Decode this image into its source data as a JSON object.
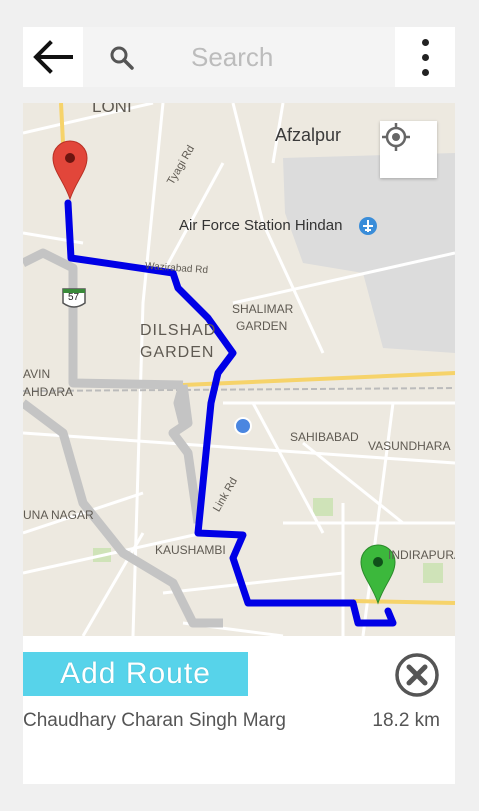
{
  "header": {
    "search_placeholder": "Search"
  },
  "map": {
    "labels": {
      "loni": "LONI",
      "afzalpur": "Afzalpur",
      "tyagi_rd": "Tyagi Rd",
      "airforce": "Air Force Station Hindan",
      "wazirabad": "Wazirabad Rd",
      "nh57": "57",
      "dilshad": "DILSHAD",
      "garden": "GARDEN",
      "shalimar": "SHALIMAR",
      "shalimar_garden": "GARDEN",
      "avin": "AVIN",
      "ahdara": "AHDARA",
      "sahibabad": "SAHIBABAD",
      "vasundhara": "VASUNDHARA",
      "link_rd": "Link Rd",
      "una_nagar": "UNA NAGAR",
      "kaushambi": "KAUSHAMBI",
      "indirapuram": "INDIRAPURA"
    },
    "colors": {
      "route": "#0000e6",
      "start_pin": "#e2463a",
      "end_pin": "#3cb83c",
      "my_location": "#4a86e0"
    }
  },
  "bottom": {
    "add_route_label": "Add Route",
    "road_name": "Chaudhary Charan Singh Marg",
    "distance": "18.2 km"
  }
}
